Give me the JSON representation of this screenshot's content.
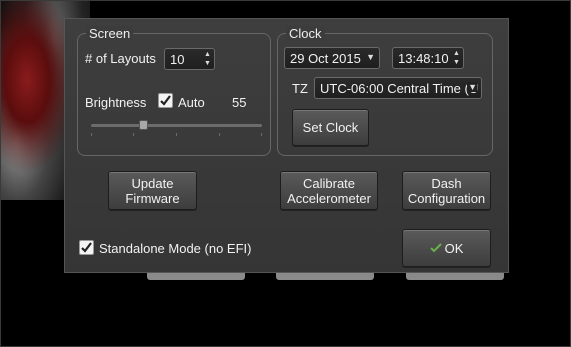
{
  "screen_group": {
    "title": "Screen",
    "layouts_label": "# of Layouts",
    "layouts_value": "10",
    "brightness_label": "Brightness",
    "auto_label": "Auto",
    "auto_checked": true,
    "brightness_value": "55",
    "brightness_level": 0.55
  },
  "clock_group": {
    "title": "Clock",
    "date_value": "29 Oct 2015",
    "time_value": "13:48:10",
    "tz_label": "TZ",
    "tz_value": "UTC-06:00 Central Time (U",
    "set_clock_label": "Set Clock"
  },
  "actions": {
    "update_firmware": "Update\nFirmware",
    "calibrate_accelerometer": "Calibrate\nAccelerometer",
    "dash_configuration": "Dash\nConfiguration"
  },
  "standalone": {
    "label": "Standalone Mode (no EFI)",
    "checked": true
  },
  "ok_button": {
    "label": "OK",
    "icon": "check-icon"
  }
}
